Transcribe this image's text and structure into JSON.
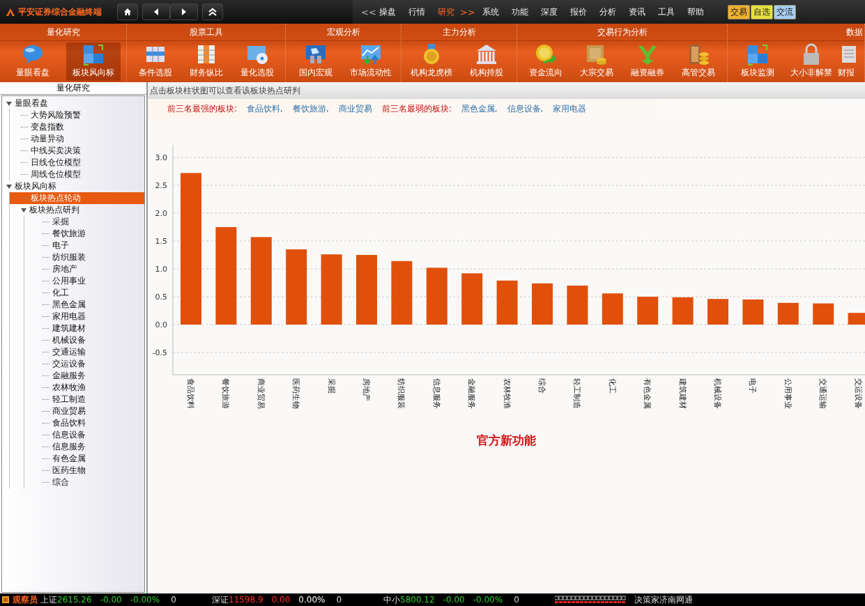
{
  "app": {
    "title": "平安证券综合金融终端"
  },
  "top_menu": [
    {
      "label": "<<",
      "kind": "arrow",
      "selected": false
    },
    {
      "label": "操盘",
      "kind": "item",
      "selected": false
    },
    {
      "label": "行情",
      "kind": "item",
      "selected": false
    },
    {
      "label": "研究",
      "kind": "item",
      "selected": true
    },
    {
      "label": ">>",
      "kind": "arrow",
      "selected": true
    },
    {
      "label": "系统",
      "kind": "item",
      "selected": false
    },
    {
      "label": "功能",
      "kind": "item",
      "selected": false
    },
    {
      "label": "深度",
      "kind": "item",
      "selected": false
    },
    {
      "label": "报价",
      "kind": "item",
      "selected": false
    },
    {
      "label": "分析",
      "kind": "item",
      "selected": false
    },
    {
      "label": "资讯",
      "kind": "item",
      "selected": false
    },
    {
      "label": "工具",
      "kind": "item",
      "selected": false
    },
    {
      "label": "帮助",
      "kind": "item",
      "selected": false
    }
  ],
  "quick_badges": [
    {
      "label": "交易",
      "color": "#f0b030"
    },
    {
      "label": "自选",
      "color": "#e8e040"
    },
    {
      "label": "交流",
      "color": "#a8cff0"
    }
  ],
  "ribbon": [
    {
      "title": "量化研究",
      "tools": [
        {
          "label": "量眼看盘",
          "selected": false
        },
        {
          "label": "板块风向标",
          "selected": true
        }
      ]
    },
    {
      "title": "股票工具",
      "tools": [
        {
          "label": "条件选股",
          "selected": false
        },
        {
          "label": "财务纵比",
          "selected": false
        },
        {
          "label": "量化选股",
          "selected": false
        }
      ]
    },
    {
      "title": "宏观分析",
      "tools": [
        {
          "label": "国内宏观",
          "selected": false
        },
        {
          "label": "市场流动性",
          "selected": false
        }
      ]
    },
    {
      "title": "主力分析",
      "tools": [
        {
          "label": "机构龙虎榜",
          "selected": false
        },
        {
          "label": "机构持股",
          "selected": false
        }
      ]
    },
    {
      "title": "交易行为分析",
      "tools": [
        {
          "label": "资金流向",
          "selected": false
        },
        {
          "label": "大宗交易",
          "selected": false
        },
        {
          "label": "融资融券",
          "selected": false
        },
        {
          "label": "高管交易",
          "selected": false
        }
      ]
    },
    {
      "title": "数据",
      "tools": [
        {
          "label": "板块监测",
          "selected": false
        },
        {
          "label": "大小非解禁",
          "selected": false
        },
        {
          "label": "财报",
          "selected": false
        }
      ]
    }
  ],
  "sidebar": {
    "title": "量化研究",
    "tree": [
      {
        "label": "量眼看盘",
        "expanded": true,
        "selected": false,
        "children": [
          {
            "label": "大势风险预警",
            "selected": false
          },
          {
            "label": "变盘指数",
            "selected": false
          },
          {
            "label": "动量异动",
            "selected": false
          },
          {
            "label": "中线买卖决策",
            "selected": false
          },
          {
            "label": "日线仓位模型",
            "selected": false
          },
          {
            "label": "周线仓位模型",
            "selected": false
          }
        ]
      },
      {
        "label": "板块风向标",
        "expanded": true,
        "selected": false,
        "children": [
          {
            "label": "板块热点轮动",
            "selected": true
          },
          {
            "label": "板块热点研判",
            "expanded": true,
            "selected": false,
            "children": [
              {
                "label": "采掘",
                "selected": false
              },
              {
                "label": "餐饮旅游",
                "selected": false
              },
              {
                "label": "电子",
                "selected": false
              },
              {
                "label": "纺织服装",
                "selected": false
              },
              {
                "label": "房地产",
                "selected": false
              },
              {
                "label": "公用事业",
                "selected": false
              },
              {
                "label": "化工",
                "selected": false
              },
              {
                "label": "黑色金属",
                "selected": false
              },
              {
                "label": "家用电器",
                "selected": false
              },
              {
                "label": "建筑建材",
                "selected": false
              },
              {
                "label": "机械设备",
                "selected": false
              },
              {
                "label": "交通运输",
                "selected": false
              },
              {
                "label": "交运设备",
                "selected": false
              },
              {
                "label": "金融服务",
                "selected": false
              },
              {
                "label": "农林牧渔",
                "selected": false
              },
              {
                "label": "轻工制造",
                "selected": false
              },
              {
                "label": "商业贸易",
                "selected": false
              },
              {
                "label": "食品饮料",
                "selected": false
              },
              {
                "label": "信息设备",
                "selected": false
              },
              {
                "label": "信息服务",
                "selected": false
              },
              {
                "label": "有色金属",
                "selected": false
              },
              {
                "label": "医药生物",
                "selected": false
              },
              {
                "label": "综合",
                "selected": false
              }
            ]
          }
        ]
      }
    ]
  },
  "main": {
    "hint": "点击板块柱状图可以查看该板块热点研判",
    "strongest": {
      "label": "前三名最强的板块:",
      "items": [
        "食品饮料,",
        "餐饮旅游,",
        "商业贸易"
      ]
    },
    "weakest": {
      "label": "前三名最弱的板块:",
      "items": [
        "黑色金属,",
        "信息设备,",
        "家用电器"
      ]
    },
    "chart_data": {
      "type": "bar",
      "categories": [
        "食品饮料",
        "餐饮旅游",
        "商业贸易",
        "医药生物",
        "采掘",
        "房地产",
        "纺织服装",
        "信息服务",
        "金融服务",
        "农林牧渔",
        "综合",
        "轻工制造",
        "化工",
        "有色金属",
        "建筑建材",
        "机械设备",
        "电子",
        "公用事业",
        "交通运输",
        "交运设备"
      ],
      "grid": true,
      "series": [
        {
          "color": "#e0500a",
          "values": [
            2.72,
            1.75,
            1.57,
            1.35,
            1.26,
            1.25,
            1.14,
            1.02,
            0.92,
            0.79,
            0.74,
            0.7,
            0.56,
            0.5,
            0.49,
            0.46,
            0.45,
            0.39,
            0.38,
            0.21
          ]
        }
      ],
      "ylim": [
        -0.9,
        3.225
      ],
      "yticks": [
        {
          "value": 3,
          "label": "3.0"
        },
        {
          "value": 2.5,
          "label": "2.5"
        },
        {
          "value": 2,
          "label": "2.0"
        },
        {
          "value": 1.5,
          "label": "1.5"
        },
        {
          "value": 1,
          "label": "1.0"
        },
        {
          "value": 0.5,
          "label": "0.5"
        },
        {
          "value": 0,
          "label": "0.0"
        },
        {
          "value": -0.5,
          "label": "-0.5"
        }
      ]
    },
    "footer_title": "官方新功能"
  },
  "status_bar": {
    "user": "观察员",
    "indices": [
      {
        "name": "上证",
        "figures": [
          {
            "text": "2615.26",
            "color": "#30d030"
          },
          {
            "text": "-0.00",
            "color": "#30d030"
          },
          {
            "text": "-0.00%",
            "color": "#30d030"
          }
        ],
        "volume": "0"
      },
      {
        "name": "深证",
        "figures": [
          {
            "text": "11598.9",
            "color": "#ff3030"
          },
          {
            "text": "0.00",
            "color": "#ff3030"
          },
          {
            "text": "0.00%",
            "color": "#ffffff"
          }
        ],
        "volume": "0"
      },
      {
        "name": "中小",
        "figures": [
          {
            "text": "5800.12",
            "color": "#30d030"
          },
          {
            "text": "-0.00",
            "color": "#30d030"
          },
          {
            "text": "-0.00%",
            "color": "#30d030"
          }
        ],
        "volume": "0"
      }
    ],
    "message": "决策家济南网通"
  }
}
